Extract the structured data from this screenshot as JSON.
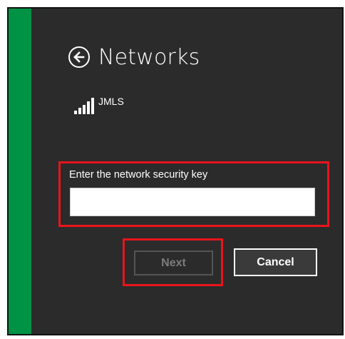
{
  "header": {
    "title": "Networks",
    "back_icon": "back-arrow-icon"
  },
  "network": {
    "name": "JMLS",
    "signal_icon": "wifi-signal-icon",
    "signal_bars": 5
  },
  "security": {
    "label": "Enter the network security key",
    "value": "",
    "placeholder": ""
  },
  "buttons": {
    "next_label": "Next",
    "cancel_label": "Cancel"
  },
  "colors": {
    "accent_bar": "#009245",
    "background": "#2b2b2b",
    "highlight": "#e8141b"
  }
}
